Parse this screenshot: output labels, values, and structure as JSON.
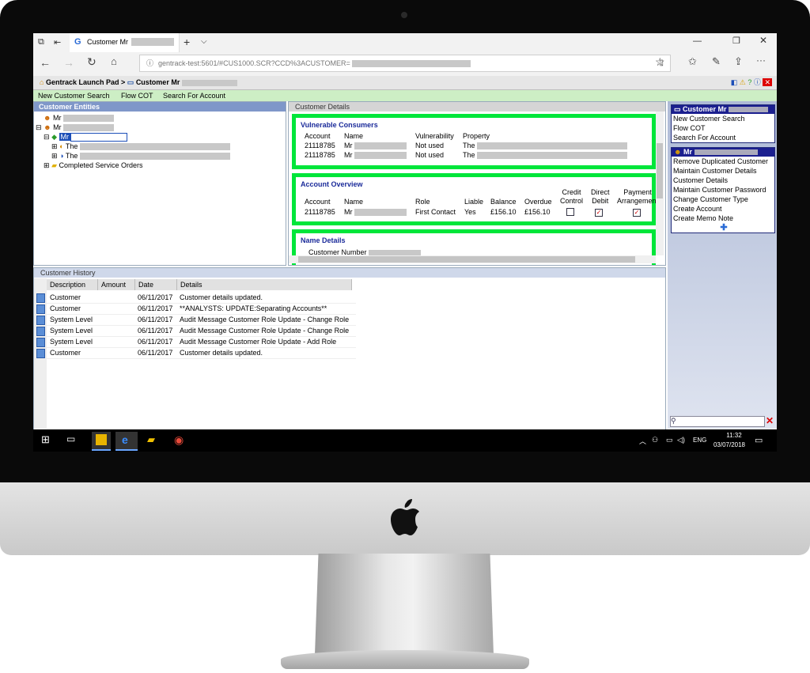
{
  "browser": {
    "tab_title": "Customer Mr",
    "url": "gentrack-test:5601/#CUS1000.SCR?CCD%3ACUSTOMER=",
    "new_tab": "+",
    "tab_menu": "⌵",
    "more": "···"
  },
  "launch_bar": {
    "item1": "Gentrack Launch Pad",
    "sep": ">",
    "item2": "Customer Mr"
  },
  "menu": [
    "New Customer Search",
    "Flow COT",
    "Search For Account"
  ],
  "entities": {
    "title": "Customer Entities",
    "nodes": [
      "Mr",
      "Mr",
      "Mr",
      "The",
      "The",
      "Completed Service Orders"
    ]
  },
  "details": {
    "title": "Customer Details",
    "vulnerable": {
      "title": "Vulnerable Consumers",
      "headers": [
        "Account",
        "Name",
        "Vulnerability",
        "Property"
      ],
      "rows": [
        [
          "21118785",
          "Mr",
          "Not used",
          "The"
        ],
        [
          "21118785",
          "Mr",
          "Not used",
          "The"
        ]
      ]
    },
    "account": {
      "title": "Account Overview",
      "headers": [
        "Account",
        "Name",
        "Role",
        "Liable",
        "Balance",
        "Overdue"
      ],
      "headers_two_line": [
        [
          "Credit",
          "Control"
        ],
        [
          "Direct",
          "Debit"
        ],
        [
          "Payment",
          "Arrangement"
        ]
      ],
      "row": [
        "21118785",
        "Mr",
        "First Contact",
        "Yes",
        "£156.10",
        "£156.10"
      ],
      "checks": [
        "",
        "✓",
        "✓"
      ]
    },
    "name_details": {
      "title": "Name Details",
      "customer_number_label": "Customer Number"
    }
  },
  "history": {
    "title": "Customer History",
    "headers": [
      "Description",
      "Amount",
      "Date",
      "Details"
    ],
    "rows": [
      [
        "Customer",
        "",
        "06/11/2017",
        "Customer details updated."
      ],
      [
        "Customer",
        "",
        "06/11/2017",
        "**ANALYSTS: UPDATE:Separating Accounts**"
      ],
      [
        "System Level",
        "",
        "06/11/2017",
        "Audit Message Customer Role Update - Change Role"
      ],
      [
        "System Level",
        "",
        "06/11/2017",
        "Audit Message Customer Role Update - Change Role"
      ],
      [
        "System Level",
        "",
        "06/11/2017",
        "Audit Message Customer Role Update - Add Role"
      ],
      [
        "Customer",
        "",
        "06/11/2017",
        "Customer details updated."
      ]
    ]
  },
  "right_panel": {
    "box1_title": "Customer Mr",
    "box1_links": [
      "New Customer Search",
      "Flow COT",
      "Search For Account"
    ],
    "box2_title": "Mr",
    "box2_links": [
      "Remove Duplicated Customer",
      "Maintain Customer Details",
      "Customer Details",
      "Maintain Customer Password",
      "Change Customer Type",
      "Create Account",
      "Create Memo Note"
    ]
  },
  "taskbar": {
    "lang": "ENG",
    "time": "11:32",
    "date": "03/07/2018"
  },
  "colors": {
    "highlight_green": "#00e63a",
    "panel_header": "#7f97c9",
    "menu_bar": "#cdeec5",
    "link_box_header": "#1b1f8f"
  }
}
